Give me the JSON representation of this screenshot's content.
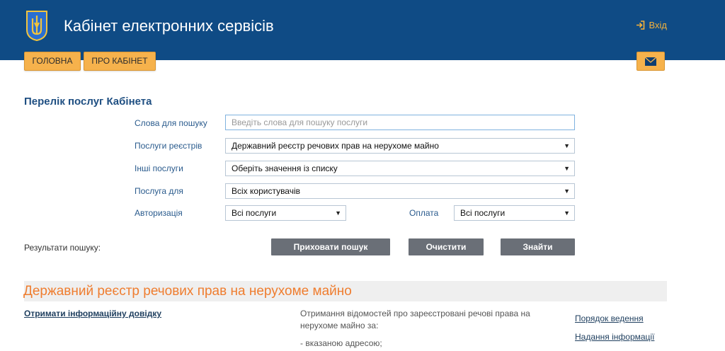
{
  "header": {
    "title": "Кабінет електронних сервісів",
    "login_label": "Вхід"
  },
  "nav": {
    "home": "ГОЛОВНА",
    "about": "ПРО КАБІНЕТ"
  },
  "section_title": "Перелік послуг Кабінета",
  "form": {
    "search_label": "Слова для пошуку",
    "search_placeholder": "Введіть слова для пошуку послуги",
    "registry_label": "Послуги реєстрів",
    "registry_value": "Державний реєстр речових прав на нерухоме майно",
    "other_label": "Інші послуги",
    "other_value": "Оберіть значення із списку",
    "for_label": "Послуга для",
    "for_value": "Всіх користувачів",
    "auth_label": "Авторизація",
    "auth_value": "Всі послуги",
    "pay_label": "Оплата",
    "pay_value": "Всі послуги"
  },
  "actions": {
    "results_label": "Результати пошуку:",
    "hide": "Приховати пошук",
    "clear": "Очистити",
    "find": "Знайти"
  },
  "registry_section": {
    "title": "Державний реєстр речових прав на нерухоме майно",
    "service_link": "Отримати інформаційну довідку",
    "desc_line1": "Отримання відомостей про зареєстровані речові права на",
    "desc_line2": "нерухоме майно за:",
    "desc_line3": "- вказаною адресою;",
    "side_link1": "Порядок ведення",
    "side_link2": "Надання інформації"
  },
  "colors": {
    "header_bg": "#0f4b85",
    "accent": "#f6b24c",
    "section_orange": "#ef7d2f"
  }
}
